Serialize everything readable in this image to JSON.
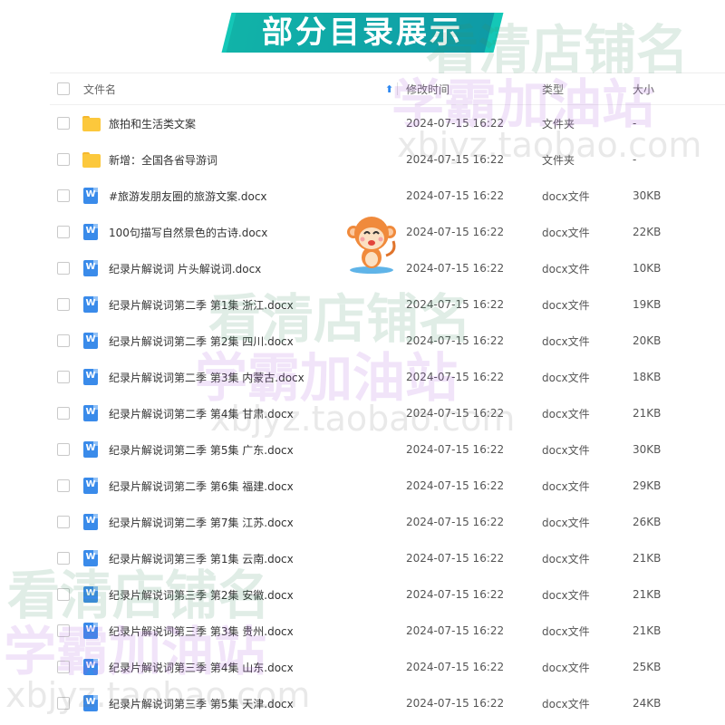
{
  "banner": {
    "title": "部分目录展示"
  },
  "table": {
    "columns": {
      "name": "文件名",
      "sort_indicator": "⬆",
      "modified": "修改时间",
      "type": "类型",
      "size": "大小"
    },
    "rows": [
      {
        "icon": "folder-icon",
        "name": "旅拍和生活类文案",
        "modified": "2024-07-15 16:22",
        "type": "文件夹",
        "size": "-"
      },
      {
        "icon": "folder-icon",
        "name": "新增：全国各省导游词",
        "modified": "2024-07-15 16:22",
        "type": "文件夹",
        "size": "-"
      },
      {
        "icon": "docx-icon",
        "name": "#旅游发朋友圈的旅游文案.docx",
        "modified": "2024-07-15 16:22",
        "type": "docx文件",
        "size": "30KB"
      },
      {
        "icon": "docx-icon",
        "name": "100句描写自然景色的古诗.docx",
        "modified": "2024-07-15 16:22",
        "type": "docx文件",
        "size": "22KB"
      },
      {
        "icon": "docx-icon",
        "name": "纪录片解说词 片头解说词.docx",
        "modified": "2024-07-15 16:22",
        "type": "docx文件",
        "size": "10KB"
      },
      {
        "icon": "docx-icon",
        "name": "纪录片解说词第二季 第1集 浙江.docx",
        "modified": "2024-07-15 16:22",
        "type": "docx文件",
        "size": "19KB"
      },
      {
        "icon": "docx-icon",
        "name": "纪录片解说词第二季 第2集 四川.docx",
        "modified": "2024-07-15 16:22",
        "type": "docx文件",
        "size": "20KB"
      },
      {
        "icon": "docx-icon",
        "name": "纪录片解说词第二季 第3集 内蒙古.docx",
        "modified": "2024-07-15 16:22",
        "type": "docx文件",
        "size": "18KB"
      },
      {
        "icon": "docx-icon",
        "name": "纪录片解说词第二季 第4集 甘肃.docx",
        "modified": "2024-07-15 16:22",
        "type": "docx文件",
        "size": "21KB"
      },
      {
        "icon": "docx-icon",
        "name": "纪录片解说词第二季 第5集 广东.docx",
        "modified": "2024-07-15 16:22",
        "type": "docx文件",
        "size": "30KB"
      },
      {
        "icon": "docx-icon",
        "name": "纪录片解说词第二季 第6集 福建.docx",
        "modified": "2024-07-15 16:22",
        "type": "docx文件",
        "size": "29KB"
      },
      {
        "icon": "docx-icon",
        "name": "纪录片解说词第二季 第7集 江苏.docx",
        "modified": "2024-07-15 16:22",
        "type": "docx文件",
        "size": "26KB"
      },
      {
        "icon": "docx-icon",
        "name": "纪录片解说词第三季 第1集 云南.docx",
        "modified": "2024-07-15 16:22",
        "type": "docx文件",
        "size": "21KB"
      },
      {
        "icon": "docx-icon",
        "name": "纪录片解说词第三季 第2集 安徽.docx",
        "modified": "2024-07-15 16:22",
        "type": "docx文件",
        "size": "21KB"
      },
      {
        "icon": "docx-icon",
        "name": "纪录片解说词第三季 第3集 贵州.docx",
        "modified": "2024-07-15 16:22",
        "type": "docx文件",
        "size": "21KB"
      },
      {
        "icon": "docx-icon",
        "name": "纪录片解说词第三季 第4集 山东.docx",
        "modified": "2024-07-15 16:22",
        "type": "docx文件",
        "size": "25KB"
      },
      {
        "icon": "docx-icon",
        "name": "纪录片解说词第三季 第5集 天津.docx",
        "modified": "2024-07-15 16:22",
        "type": "docx文件",
        "size": "24KB"
      }
    ]
  },
  "watermarks": {
    "line1": "看清店铺名",
    "line2": "学霸加油站",
    "url": "xbjyz.taobao.com"
  }
}
